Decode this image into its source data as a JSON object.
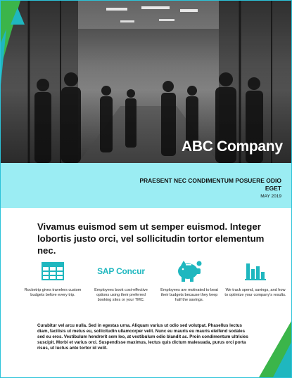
{
  "hero": {
    "company_name": "ABC Company"
  },
  "band": {
    "title": "PRAESENT NEC CONDIMENTUM POSUERE ODIO EGET",
    "date": "MAY 2019"
  },
  "headline": "Vivamus euismod sem ut semper euismod. Integer lobortis justo orci, vel sollicitudin tortor elementum nec.",
  "features": [
    {
      "icon": "spreadsheet-grid-icon",
      "caption": "Rocketrip gives travelers custom budgets before every trip."
    },
    {
      "icon": "sap-concur-logo",
      "label": "SAP Concur",
      "caption": "Employees book cost-effective options using their preferred booking sites or your TMC."
    },
    {
      "icon": "piggy-bank-icon",
      "caption": "Employees are motivated to beat their budgets because they keep half the savings."
    },
    {
      "icon": "bar-chart-icon",
      "caption": "We track spend, savings, and how to optimize your company's results."
    }
  ],
  "body_text": "Curabitur vel arcu nulla. Sed in egestas urna. Aliquam varius ut odio sed volutpat. Phasellus lectus diam, facilisis ut metus eu, sollicitudin ullamcorper velit. Nunc eu mauris eu mauris eleifend sodales sed eu eros. Vestibulum hendrerit sem leo, at vestibulum odio blandit ac. Proin condimentum ultricies suscipit. Morbi et varius orci. Suspendisse maximus, lectus quis dictum malesuada, purus orci porta risus, ut luctus ante tortor id velit.",
  "colors": {
    "accent_teal": "#1fb7bf",
    "accent_green": "#3bb54a",
    "band_cyan": "#9bedf3",
    "border": "#2bc3d9"
  }
}
